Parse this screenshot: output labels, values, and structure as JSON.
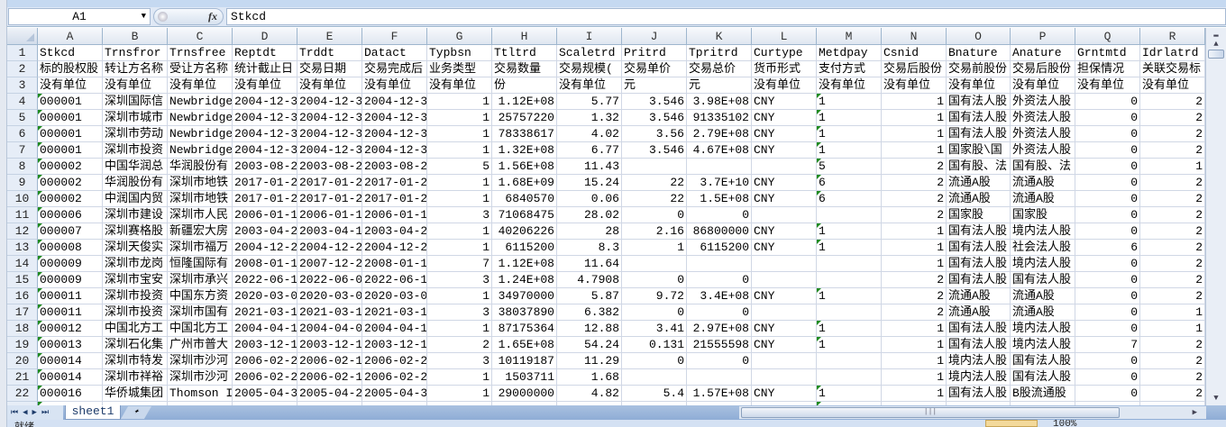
{
  "formula_bar": {
    "name_box": "A1",
    "fx_label": "fx",
    "formula": "Stkcd"
  },
  "columns": [
    "A",
    "B",
    "C",
    "D",
    "E",
    "F",
    "G",
    "H",
    "I",
    "J",
    "K",
    "L",
    "M",
    "N",
    "O",
    "P",
    "Q",
    "R"
  ],
  "right_aligned_columns": [
    "G",
    "H",
    "I",
    "J",
    "K",
    "N",
    "Q",
    "R"
  ],
  "rows": [
    [
      "Stkcd",
      "Trnsfror",
      "Trnsfree",
      "Reptdt",
      "Trddt",
      "Datact",
      "Typbsn",
      "Ttltrd",
      "Scaletrd",
      "Pritrd",
      "Tpritrd",
      "Curtype",
      "Metdpay",
      "Csnid",
      "Bnature",
      "Anature",
      "Grntmtd",
      "Idrlatrd"
    ],
    [
      "标的股权股",
      "转让方名称",
      "受让方名称",
      "统计截止日",
      "交易日期",
      "交易完成后",
      "业务类型",
      "交易数量",
      "交易规模(",
      "交易单价",
      "交易总价",
      "货币形式",
      "支付方式",
      "交易后股份",
      "交易前股份",
      "交易后股份",
      "担保情况",
      "关联交易标"
    ],
    [
      "没有单位",
      "没有单位",
      "没有单位",
      "没有单位",
      "没有单位",
      "没有单位",
      "没有单位",
      "份",
      "没有单位",
      "元",
      "元",
      "没有单位",
      "没有单位",
      "没有单位",
      "没有单位",
      "没有单位",
      "没有单位",
      "没有单位"
    ],
    [
      "000001",
      "深圳国际信",
      "Newbridge",
      "2004-12-3",
      "2004-12-3",
      "2004-12-3",
      "1",
      "1.12E+08",
      "5.77",
      "3.546",
      "3.98E+08",
      "CNY",
      "1",
      "1",
      "国有法人股",
      "外资法人股",
      "0",
      "2"
    ],
    [
      "000001",
      "深圳市城市",
      "Newbridge",
      "2004-12-3",
      "2004-12-3",
      "2004-12-3",
      "1",
      "25757220",
      "1.32",
      "3.546",
      "91335102",
      "CNY",
      "1",
      "1",
      "国有法人股",
      "外资法人股",
      "0",
      "2"
    ],
    [
      "000001",
      "深圳市劳动",
      "Newbridge",
      "2004-12-3",
      "2004-12-3",
      "2004-12-3",
      "1",
      "78338617",
      "4.02",
      "3.56",
      "2.79E+08",
      "CNY",
      "1",
      "1",
      "国有法人股",
      "外资法人股",
      "0",
      "2"
    ],
    [
      "000001",
      "深圳市投资",
      "Newbridge",
      "2004-12-3",
      "2004-12-3",
      "2004-12-3",
      "1",
      "1.32E+08",
      "6.77",
      "3.546",
      "4.67E+08",
      "CNY",
      "1",
      "1",
      "国家股\\国",
      "外资法人股",
      "0",
      "2"
    ],
    [
      "000002",
      "中国华润总",
      "华润股份有",
      "2003-08-2",
      "2003-08-2",
      "2003-08-2",
      "5",
      "1.56E+08",
      "11.43",
      "",
      "",
      "",
      "5",
      "2",
      "国有股、法",
      "国有股、法",
      "0",
      "1"
    ],
    [
      "000002",
      "华润股份有",
      "深圳市地铁",
      "2017-01-2",
      "2017-01-2",
      "2017-01-2",
      "1",
      "1.68E+09",
      "15.24",
      "22",
      "3.7E+10",
      "CNY",
      "6",
      "2",
      "流通A股",
      "流通A股",
      "0",
      "2"
    ],
    [
      "000002",
      "中润国内贸",
      "深圳市地铁",
      "2017-01-2",
      "2017-01-2",
      "2017-01-2",
      "1",
      "6840570",
      "0.06",
      "22",
      "1.5E+08",
      "CNY",
      "6",
      "2",
      "流通A股",
      "流通A股",
      "0",
      "2"
    ],
    [
      "000006",
      "深圳市建设",
      "深圳市人民",
      "2006-01-1",
      "2006-01-1",
      "2006-01-1",
      "3",
      "71068475",
      "28.02",
      "0",
      "0",
      "",
      "",
      "2",
      "国家股",
      "国家股",
      "0",
      "2"
    ],
    [
      "000007",
      "深圳赛格股",
      "新疆宏大房",
      "2003-04-2",
      "2003-04-1",
      "2003-04-2",
      "1",
      "40206226",
      "28",
      "2.16",
      "86800000",
      "CNY",
      "1",
      "1",
      "国有法人股",
      "境内法人股",
      "0",
      "2"
    ],
    [
      "000008",
      "深圳天俊实",
      "深圳市福万",
      "2004-12-2",
      "2004-12-2",
      "2004-12-2",
      "1",
      "6115200",
      "8.3",
      "1",
      "6115200",
      "CNY",
      "1",
      "1",
      "国有法人股",
      "社会法人股",
      "6",
      "2"
    ],
    [
      "000009",
      "深圳市龙岗",
      "恒隆国际有",
      "2008-01-1",
      "2007-12-2",
      "2008-01-1",
      "7",
      "1.12E+08",
      "11.64",
      "",
      "",
      "",
      "",
      "1",
      "国有法人股",
      "境内法人股",
      "0",
      "2"
    ],
    [
      "000009",
      "深圳市宝安",
      "深圳市承兴",
      "2022-06-1",
      "2022-06-0",
      "2022-06-1",
      "3",
      "1.24E+08",
      "4.7908",
      "0",
      "0",
      "",
      "",
      "2",
      "国有法人股",
      "国有法人股",
      "0",
      "2"
    ],
    [
      "000011",
      "深圳市投资",
      "中国东方资",
      "2020-03-0",
      "2020-03-0",
      "2020-03-0",
      "1",
      "34970000",
      "5.87",
      "9.72",
      "3.4E+08",
      "CNY",
      "1",
      "2",
      "流通A股",
      "流通A股",
      "0",
      "2"
    ],
    [
      "000011",
      "深圳市投资",
      "深圳市国有",
      "2021-03-1",
      "2021-03-1",
      "2021-03-1",
      "3",
      "38037890",
      "6.382",
      "0",
      "0",
      "",
      "",
      "2",
      "流通A股",
      "流通A股",
      "0",
      "1"
    ],
    [
      "000012",
      "中国北方工",
      "中国北方工",
      "2004-04-1",
      "2004-04-0",
      "2004-04-1",
      "1",
      "87175364",
      "12.88",
      "3.41",
      "2.97E+08",
      "CNY",
      "1",
      "1",
      "国有法人股",
      "境内法人股",
      "0",
      "1"
    ],
    [
      "000013",
      "深圳石化集",
      "广州市普大",
      "2003-12-1",
      "2003-12-1",
      "2003-12-1",
      "2",
      "1.65E+08",
      "54.24",
      "0.131",
      "21555598",
      "CNY",
      "1",
      "1",
      "国有法人股",
      "境内法人股",
      "7",
      "2"
    ],
    [
      "000014",
      "深圳市特发",
      "深圳市沙河",
      "2006-02-2",
      "2006-02-1",
      "2006-02-2",
      "3",
      "10119187",
      "11.29",
      "0",
      "0",
      "",
      "",
      "1",
      "境内法人股",
      "国有法人股",
      "0",
      "2"
    ],
    [
      "000014",
      "深圳市祥裕",
      "深圳市沙河",
      "2006-02-2",
      "2006-02-1",
      "2006-02-2",
      "1",
      "1503711",
      "1.68",
      "",
      "",
      "",
      "",
      "1",
      "境内法人股",
      "国有法人股",
      "0",
      "2"
    ],
    [
      "000016",
      "华侨城集团",
      "Thomson I",
      "2005-04-3",
      "2005-04-2",
      "2005-04-3",
      "1",
      "29000000",
      "4.82",
      "5.4",
      "1.57E+08",
      "CNY",
      "1",
      "1",
      "国有法人股",
      "B股流通股",
      "0",
      "2"
    ]
  ],
  "sheet_tabs": [
    {
      "label": "sheet1",
      "active": true
    }
  ],
  "status_bar": {
    "ready": "就绪",
    "zoom": "100%"
  },
  "colors": {
    "grid_line": "#d0d7e5",
    "header_border": "#9eb6ce",
    "error_triangle": "#1f8a1f",
    "chrome_blue": "#c5d9f1"
  }
}
